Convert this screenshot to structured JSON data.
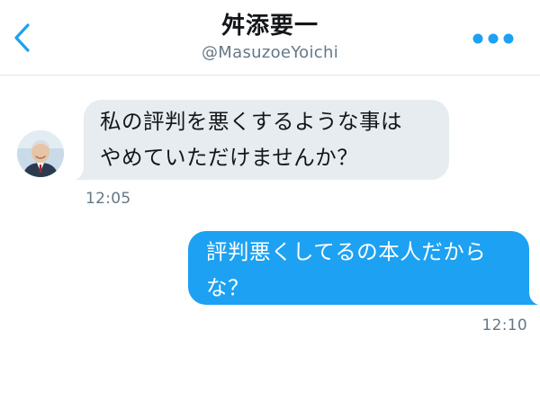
{
  "header": {
    "title": "舛添要一",
    "handle": "@MasuzoeYoichi",
    "back_icon": "chevron-left-icon",
    "more_icon": "more-horizontal-icon",
    "accent_color": "#1da1f2"
  },
  "messages": [
    {
      "direction": "incoming",
      "lines": [
        "私の評判を悪くするような事は",
        "やめていただけませんか？"
      ],
      "time": "12:05",
      "bubble_color": "#e6ecf0"
    },
    {
      "direction": "outgoing",
      "lines": [
        "評判悪くしてるの本人だから",
        "な？"
      ],
      "time": "12:10",
      "bubble_color": "#1da1f2"
    }
  ]
}
